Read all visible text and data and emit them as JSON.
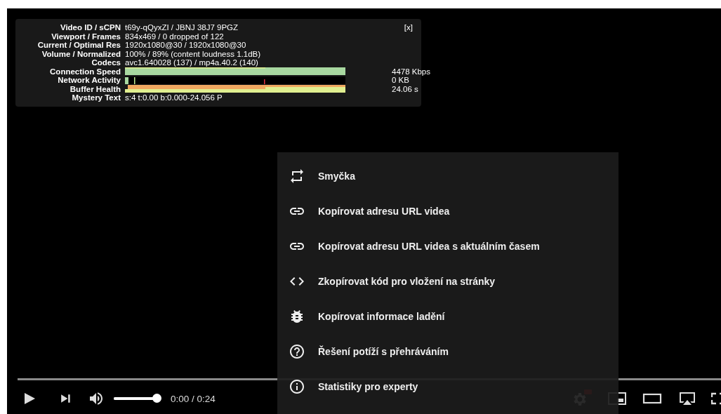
{
  "stats_panel": {
    "close": "[x]",
    "rows": [
      {
        "kind": "text",
        "label": "Video ID / sCPN",
        "value": "t69y-qQyxZI / JBNJ 38J7 9PGZ"
      },
      {
        "kind": "text",
        "label": "Viewport / Frames",
        "value": "834x469 / 0 dropped of 122"
      },
      {
        "kind": "text",
        "label": "Current / Optimal Res",
        "value": "1920x1080@30 / 1920x1080@30"
      },
      {
        "kind": "text",
        "label": "Volume / Normalized",
        "value": "100% / 89% (content loudness 1.1dB)"
      },
      {
        "kind": "text",
        "label": "Codecs",
        "value": "avc1.640028 (137) / mp4a.40.2 (140)"
      },
      {
        "kind": "speed-graph",
        "label": "Connection Speed",
        "reading": "4478 Kbps"
      },
      {
        "kind": "network-graph",
        "label": "Network Activity",
        "reading": "0 KB"
      },
      {
        "kind": "buffer-graph",
        "label": "Buffer Health",
        "reading": "24.06 s"
      },
      {
        "kind": "text",
        "label": "Mystery Text",
        "value": "s:4 t:0.00 b:0.000-24.056 P"
      }
    ]
  },
  "context_menu": {
    "items": [
      {
        "kind": "loop",
        "label": "Smyčka"
      },
      {
        "kind": "link",
        "label": "Kopírovat adresu URL videa"
      },
      {
        "kind": "link",
        "label": "Kopírovat adresu URL videa s aktuálním časem"
      },
      {
        "kind": "embed",
        "label": "Zkopírovat kód pro vložení na stránky"
      },
      {
        "kind": "bug",
        "label": "Kopírovat informace ladění"
      },
      {
        "kind": "help",
        "label": "Řešení potíží s přehráváním"
      },
      {
        "kind": "info",
        "label": "Statistiky pro experty"
      }
    ]
  },
  "controls": {
    "progress": {
      "level": 0
    },
    "volume": {
      "level": 1
    },
    "time": "0:00 / 0:24"
  }
}
